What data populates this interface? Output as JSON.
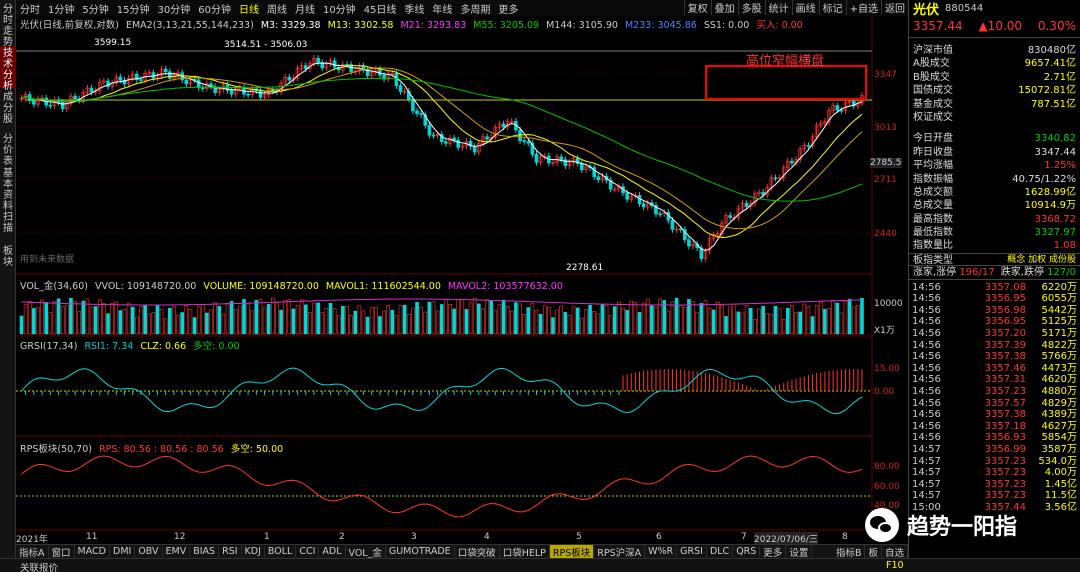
{
  "left_tabs": [
    "分时走势",
    "技术分析",
    "成分股",
    "分价表",
    "基本资料",
    "扫描",
    "板块"
  ],
  "toolbar": {
    "periods": [
      "分时",
      "1分钟",
      "5分钟",
      "15分钟",
      "30分钟",
      "60分钟",
      "日线",
      "周线",
      "月线",
      "10分钟",
      "45日线",
      "季线",
      "年线",
      "多周期",
      "更多"
    ],
    "active": "日线",
    "right": [
      "复权",
      "叠加",
      "多股",
      "统计",
      "画线",
      "标记",
      "+自选",
      "返回"
    ]
  },
  "main_legend": {
    "title": "光伏(日线,前复权,对数)",
    "ema": "EMA2(3,13,21,55,144,233)",
    "m3": "M3: 3329.38",
    "m13": "M13: 3302.58",
    "m21": "M21: 3293.83",
    "m55": "M55: 3205.09",
    "m144": "M144: 3105.90",
    "m233": "M233: 3045.86",
    "ss1": "SS1: 0.00",
    "ss2": "买入: 0.00"
  },
  "annotations": {
    "high1": "3599.15",
    "high2": "3514.51 - 3506.03",
    "low": "2278.61",
    "box_label": "高位窄幅横盘",
    "watermark_note": "用到未来数据"
  },
  "price_axis": [
    "3347",
    "3013",
    "2785.5",
    "2711",
    "2440"
  ],
  "vol_legend": {
    "name": "VOL_金(34,60)",
    "vvol": "VVOL: 109148720.00",
    "volume": "VOLUME: 109148720.00",
    "mavol1": "MAVOL1: 111602544.00",
    "mavol2": "MAVOL2: 103577632.00"
  },
  "vol_axis": [
    "10000",
    "X1万"
  ],
  "grsi_legend": {
    "name": "GRSI(17,34)",
    "rsi1": "RSI1: 7.34",
    "clz": "CLZ: 0.66",
    "dk": "多空: 0.00"
  },
  "grsi_axis": [
    "15.00",
    "0.00"
  ],
  "rps_legend": {
    "name": "RPS板块(50,70)",
    "rps": "RPS: 80.56",
    "v1": ": 80.56",
    "v2": ": 80.56",
    "dk": "多空: 50.00"
  },
  "rps_axis": [
    "80.00",
    "60.00",
    "40.00"
  ],
  "date_axis": [
    "2021年",
    "11",
    "12",
    "1",
    "2",
    "3",
    "4",
    "5",
    "6",
    "7",
    "2022/07/06/三",
    "8"
  ],
  "bottom_tabs": [
    "指标A",
    "窗口",
    "MACD",
    "DMI",
    "OBV",
    "EMV",
    "BIAS",
    "RSI",
    "KDJ",
    "BOLL",
    "CCI",
    "ADL",
    "VOL_金",
    "GUMOTRADE",
    "口袋突破",
    "口袋HELP",
    "RPS板块",
    "RPS沪深A",
    "W%R",
    "GRSI",
    "DLC",
    "QRS",
    "更多",
    "设置"
  ],
  "bottom_active": "RPS板块",
  "bottom_right": [
    "指标B",
    "板",
    "自选"
  ],
  "status": "关联报价",
  "status_right": "F10",
  "quote": {
    "name": "光伏",
    "code": "880544",
    "price": "3357.44",
    "change": "▲10.00",
    "pct": "0.30%"
  },
  "info_rows": [
    {
      "k": "沪深市值",
      "v": "830480亿",
      "c": "w"
    },
    {
      "k": "A股成交",
      "v": "9657.41亿",
      "c": "y"
    },
    {
      "k": "B股成交",
      "v": "2.71亿",
      "c": "y"
    },
    {
      "k": "国债成交",
      "v": "15072.81亿",
      "c": "y"
    },
    {
      "k": "基金成交",
      "v": "787.51亿",
      "c": "y"
    },
    {
      "k": "权证成交",
      "v": "",
      "c": "y"
    },
    {
      "k": "今日开盘",
      "v": "3340.82",
      "c": "g"
    },
    {
      "k": "昨日收盘",
      "v": "3347.44",
      "c": "w"
    },
    {
      "k": "平均涨幅",
      "v": "1.25%",
      "c": "r"
    },
    {
      "k": "指数振幅",
      "v": "40.75/1.22%",
      "c": "w"
    },
    {
      "k": "总成交额",
      "v": "1628.99亿",
      "c": "y"
    },
    {
      "k": "总成交量",
      "v": "10914.9万",
      "c": "y"
    },
    {
      "k": "最高指数",
      "v": "3368.72",
      "c": "r"
    },
    {
      "k": "最低指数",
      "v": "3327.97",
      "c": "g"
    },
    {
      "k": "指数量比",
      "v": "1.08",
      "c": "r"
    }
  ],
  "board": {
    "label": "板指类型",
    "val": "概念 加权 成份股"
  },
  "updown": {
    "up_label": "涨家,涨停",
    "up": "196/17",
    "down_label": "跌家,跌停",
    "down": "127/0"
  },
  "ticks": [
    [
      "14:56",
      "3357.08",
      "6220万"
    ],
    [
      "14:56",
      "3356.95",
      "6055万"
    ],
    [
      "14:56",
      "3356.98",
      "5442万"
    ],
    [
      "14:56",
      "3356.95",
      "5125万"
    ],
    [
      "14:56",
      "3357.20",
      "5171万"
    ],
    [
      "14:56",
      "3357.39",
      "4822万"
    ],
    [
      "14:56",
      "3357.38",
      "5766万"
    ],
    [
      "14:56",
      "3357.46",
      "4473万"
    ],
    [
      "14:56",
      "3357.31",
      "4620万"
    ],
    [
      "14:56",
      "3357.23",
      "4880万"
    ],
    [
      "14:56",
      "3357.57",
      "4829万"
    ],
    [
      "14:56",
      "3357.38",
      "4389万"
    ],
    [
      "14:56",
      "3357.18",
      "4627万"
    ],
    [
      "14:56",
      "3356.93",
      "5854万"
    ],
    [
      "14:57",
      "3356.99",
      "3587万"
    ],
    [
      "14:57",
      "3357.23",
      "534.0万"
    ],
    [
      "14:57",
      "3357.23",
      "4.00万"
    ],
    [
      "14:57",
      "3357.23",
      "1.45亿"
    ],
    [
      "14:57",
      "3357.23",
      "11.5亿"
    ],
    [
      "15:00",
      "3357.44",
      "3.56亿"
    ]
  ],
  "watermark": "趋势一阳指",
  "colors": {
    "up": "#ff3333",
    "down": "#00d8d8",
    "ma1": "#ffffff",
    "ma2": "#ffff00",
    "ma3": "#d0a000",
    "ma4": "#00c000",
    "ma5": "#cc33cc"
  }
}
